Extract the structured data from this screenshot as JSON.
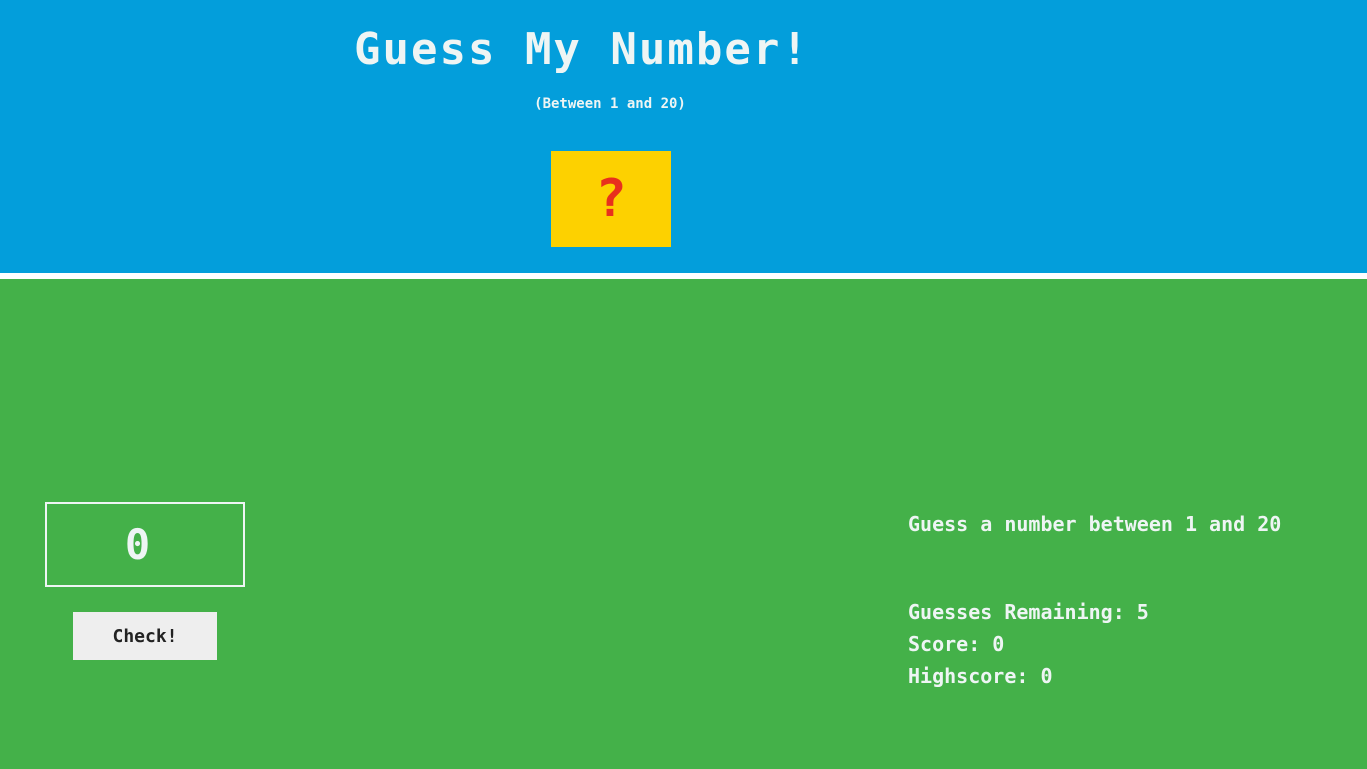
{
  "header": {
    "title": "Guess My Number!",
    "subtitle": "(Between 1 and 20)",
    "mystery_symbol": "?"
  },
  "controls": {
    "guess_value": "0",
    "check_label": "Check!"
  },
  "status": {
    "message": "Guess a number between 1 and 20",
    "guesses_label": "Guesses Remaining:",
    "guesses_value": "5",
    "score_label": "Score:",
    "score_value": "0",
    "highscore_label": "Highscore:",
    "highscore_value": "0"
  },
  "colors": {
    "header_background": "#039edb",
    "main_background": "#44b149",
    "mystery_box": "#fdd100",
    "mystery_symbol": "#e8301d",
    "text": "#eef5f4"
  }
}
